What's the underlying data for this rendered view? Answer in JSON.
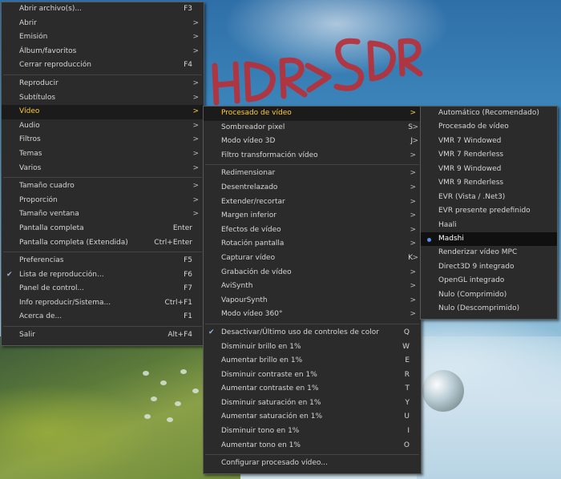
{
  "main_menu": [
    {
      "label": "Abrir archivo(s)...",
      "accel": "F3"
    },
    {
      "label": "Abrir",
      "arrow": ">"
    },
    {
      "label": "Emisión",
      "arrow": ">"
    },
    {
      "label": "Álbum/favoritos",
      "arrow": ">"
    },
    {
      "label": "Cerrar reproducción",
      "accel": "F4"
    },
    {
      "sep": true
    },
    {
      "label": "Reproducir",
      "arrow": ">"
    },
    {
      "label": "Subtítulos",
      "arrow": ">"
    },
    {
      "label": "Vídeo",
      "arrow": ">",
      "highlight": true
    },
    {
      "label": "Audio",
      "arrow": ">"
    },
    {
      "label": "Filtros",
      "arrow": ">"
    },
    {
      "label": "Temas",
      "arrow": ">"
    },
    {
      "label": "Varios",
      "arrow": ">"
    },
    {
      "sep": true
    },
    {
      "label": "Tamaño cuadro",
      "arrow": ">"
    },
    {
      "label": "Proporción",
      "arrow": ">"
    },
    {
      "label": "Tamaño ventana",
      "arrow": ">"
    },
    {
      "label": "Pantalla completa",
      "accel": "Enter"
    },
    {
      "label": "Pantalla completa (Extendida)",
      "accel": "Ctrl+Enter"
    },
    {
      "sep": true
    },
    {
      "label": "Preferencias",
      "accel": "F5"
    },
    {
      "label": "Lista de reproducción...",
      "accel": "F6",
      "checked": true
    },
    {
      "label": "Panel de control...",
      "accel": "F7"
    },
    {
      "label": "Info reproducir/Sistema...",
      "accel": "Ctrl+F1"
    },
    {
      "label": "Acerca de...",
      "accel": "F1"
    },
    {
      "sep": true
    },
    {
      "label": "Salir",
      "accel": "Alt+F4"
    }
  ],
  "video_menu": [
    {
      "label": "Procesado de vídeo",
      "arrow": ">",
      "highlight": true
    },
    {
      "label": "Sombreador pixel",
      "accel": "S",
      "arrow": ">"
    },
    {
      "label": "Modo vídeo 3D",
      "accel": "J",
      "arrow": ">"
    },
    {
      "label": "Filtro transformación vídeo",
      "arrow": ">"
    },
    {
      "sep": true
    },
    {
      "label": "Redimensionar",
      "arrow": ">"
    },
    {
      "label": "Desentrelazado",
      "arrow": ">"
    },
    {
      "label": "Extender/recortar",
      "arrow": ">"
    },
    {
      "label": "Margen inferior",
      "arrow": ">"
    },
    {
      "label": "Efectos de vídeo",
      "arrow": ">"
    },
    {
      "label": "Rotación pantalla",
      "arrow": ">"
    },
    {
      "label": "Capturar vídeo",
      "accel": "K",
      "arrow": ">"
    },
    {
      "label": "Grabación de vídeo",
      "arrow": ">"
    },
    {
      "label": "AviSynth",
      "arrow": ">"
    },
    {
      "label": "VapourSynth",
      "arrow": ">"
    },
    {
      "label": "Modo vídeo 360°",
      "arrow": ">"
    },
    {
      "sep": true
    },
    {
      "label": "Desactivar/Último uso de controles de color",
      "accel": "Q",
      "checked": true
    },
    {
      "label": "Disminuir brillo en 1%",
      "accel": "W"
    },
    {
      "label": "Aumentar brillo en 1%",
      "accel": "E"
    },
    {
      "label": "Disminuir contraste en 1%",
      "accel": "R"
    },
    {
      "label": "Aumentar contraste en 1%",
      "accel": "T"
    },
    {
      "label": "Disminuir saturación en 1%",
      "accel": "Y"
    },
    {
      "label": "Aumentar saturación en 1%",
      "accel": "U"
    },
    {
      "label": "Disminuir tono en 1%",
      "accel": "I"
    },
    {
      "label": "Aumentar tono en 1%",
      "accel": "O"
    },
    {
      "sep": true
    },
    {
      "label": "Configurar procesado vídeo..."
    }
  ],
  "renderer_menu": [
    {
      "label": "Automático (Recomendado)"
    },
    {
      "label": "Procesado de vídeo"
    },
    {
      "label": "VMR 7 Windowed"
    },
    {
      "label": "VMR 7 Renderless"
    },
    {
      "label": "VMR 9 Windowed"
    },
    {
      "label": "VMR 9 Renderless"
    },
    {
      "label": "EVR (Vista / .Net3)"
    },
    {
      "label": "EVR presente predefinido"
    },
    {
      "label": "Haali"
    },
    {
      "label": "Madshi",
      "selected": true
    },
    {
      "label": "Renderizar vídeo MPC"
    },
    {
      "label": "Direct3D 9 integrado"
    },
    {
      "label": "OpenGL integrado"
    },
    {
      "label": "Nulo (Comprimido)"
    },
    {
      "label": "Nulo (Descomprimido)"
    }
  ],
  "annotation": {
    "text": "HDR>SDR",
    "color": "#b8303a"
  }
}
